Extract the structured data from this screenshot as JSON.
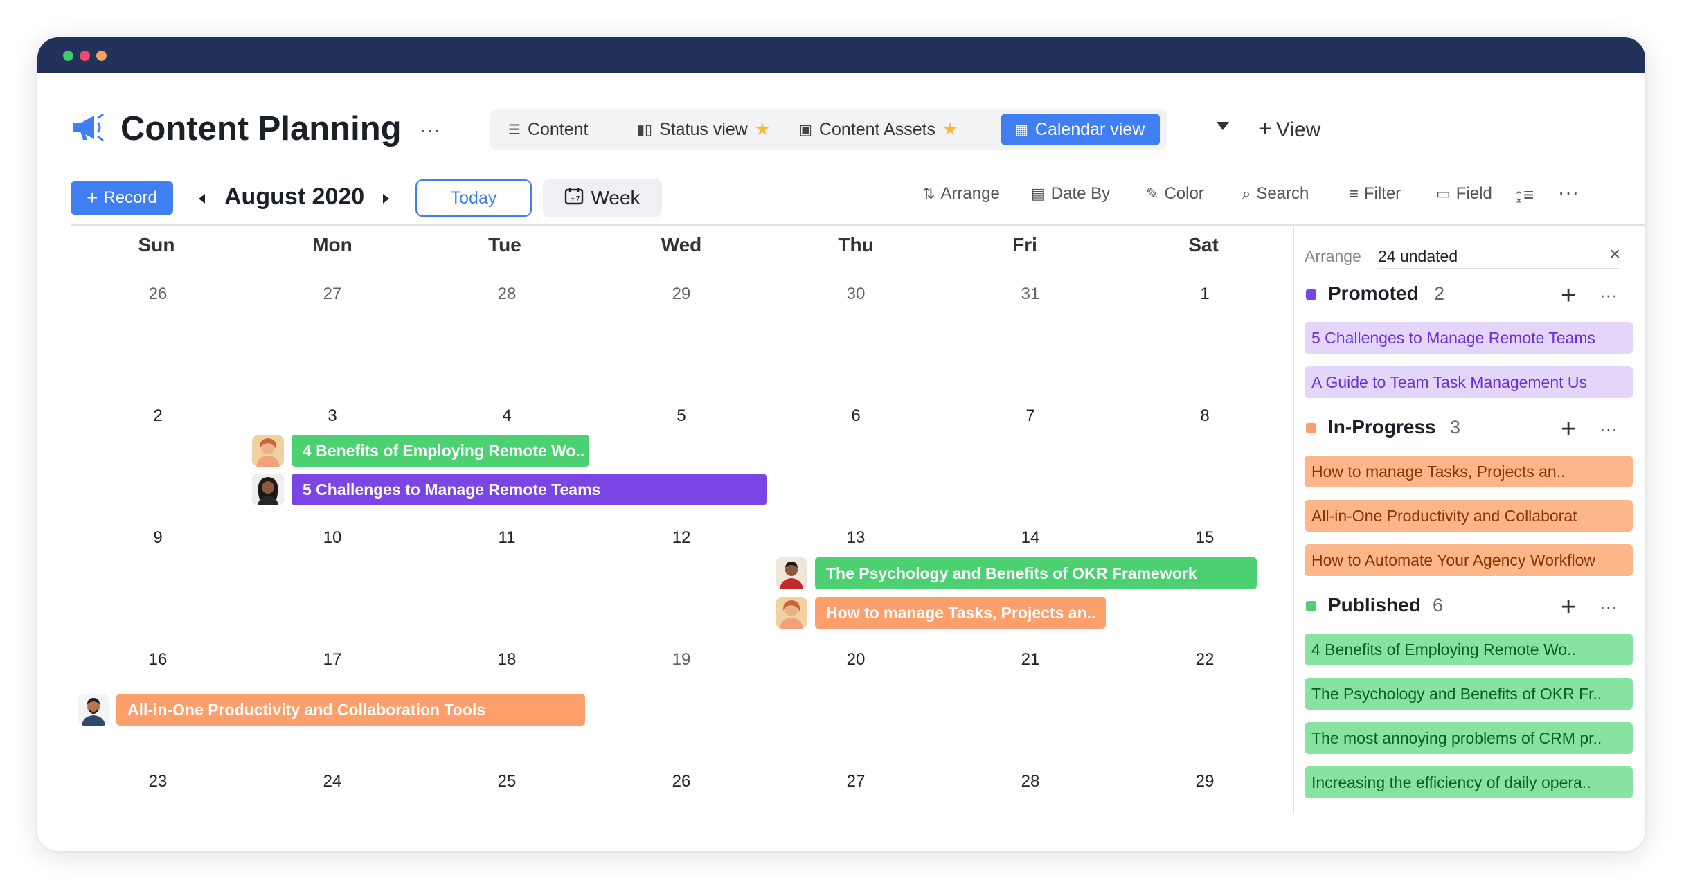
{
  "app": {
    "title": "Content Planning",
    "view_tabs": [
      {
        "label": "Content",
        "icon": "list-icon",
        "starred": false,
        "active": false
      },
      {
        "label": "Status view",
        "icon": "columns-icon",
        "starred": true,
        "active": false
      },
      {
        "label": "Content Assets",
        "icon": "image-icon",
        "starred": true,
        "active": false
      },
      {
        "label": "Calendar view",
        "icon": "calendar-icon",
        "starred": false,
        "active": true
      }
    ],
    "add_view_label": "View"
  },
  "toolbar": {
    "record_label": "Record",
    "month": "August 2020",
    "today_label": "Today",
    "week_label": "Week",
    "arrange_label": "Arrange",
    "date_by_label": "Date By",
    "color_label": "Color",
    "search_label": "Search",
    "filter_label": "Filter",
    "field_label": "Field"
  },
  "calendar": {
    "weekdays": [
      "Sun",
      "Mon",
      "Tue",
      "Wed",
      "Thu",
      "Fri",
      "Sat"
    ],
    "weeks": [
      [
        "26",
        "27",
        "28",
        "29",
        "30",
        "31",
        "1"
      ],
      [
        "2",
        "3",
        "4",
        "5",
        "6",
        "7",
        "8"
      ],
      [
        "9",
        "10",
        "11",
        "12",
        "13",
        "14",
        "15"
      ],
      [
        "16",
        "17",
        "18",
        "19",
        "20",
        "21",
        "22"
      ],
      [
        "23",
        "24",
        "25",
        "26",
        "27",
        "28",
        "29"
      ]
    ],
    "events": [
      {
        "title": "4 Benefits of Employing Remote Wo..",
        "status": "Published"
      },
      {
        "title": "5 Challenges to Manage Remote Teams",
        "status": "Promoted"
      },
      {
        "title": "The Psychology and Benefits of OKR Framework",
        "status": "Published"
      },
      {
        "title": "How to manage Tasks, Projects an..",
        "status": "In-Progress"
      },
      {
        "title": "All-in-One Productivity and Collaboration Tools",
        "status": "In-Progress"
      }
    ]
  },
  "sidebar": {
    "arrange_label": "Arrange",
    "undated_label": "24 undated",
    "groups": [
      {
        "name": "Promoted",
        "count": "2",
        "color": "#7b45e6",
        "items": [
          "5 Challenges to Manage Remote Teams",
          "A Guide to Team Task Management Us"
        ]
      },
      {
        "name": "In-Progress",
        "count": "3",
        "color": "#fd9f6b",
        "items": [
          "How to manage Tasks, Projects an..",
          "All-in-One Productivity and Collaborat",
          "How to Automate Your Agency Workflow"
        ]
      },
      {
        "name": "Published",
        "count": "6",
        "color": "#4cd072",
        "items": [
          "4 Benefits of Employing Remote Wo..",
          "The Psychology and Benefits of OKR Fr..",
          "The most annoying problems of CRM pr..",
          "Increasing the efficiency of daily opera.."
        ]
      }
    ]
  },
  "colors": {
    "accent": "#3f7ff2",
    "titlebar": "#213359",
    "promoted": "#7b45e6",
    "in_progress": "#fd9f6b",
    "published": "#4cd072"
  }
}
